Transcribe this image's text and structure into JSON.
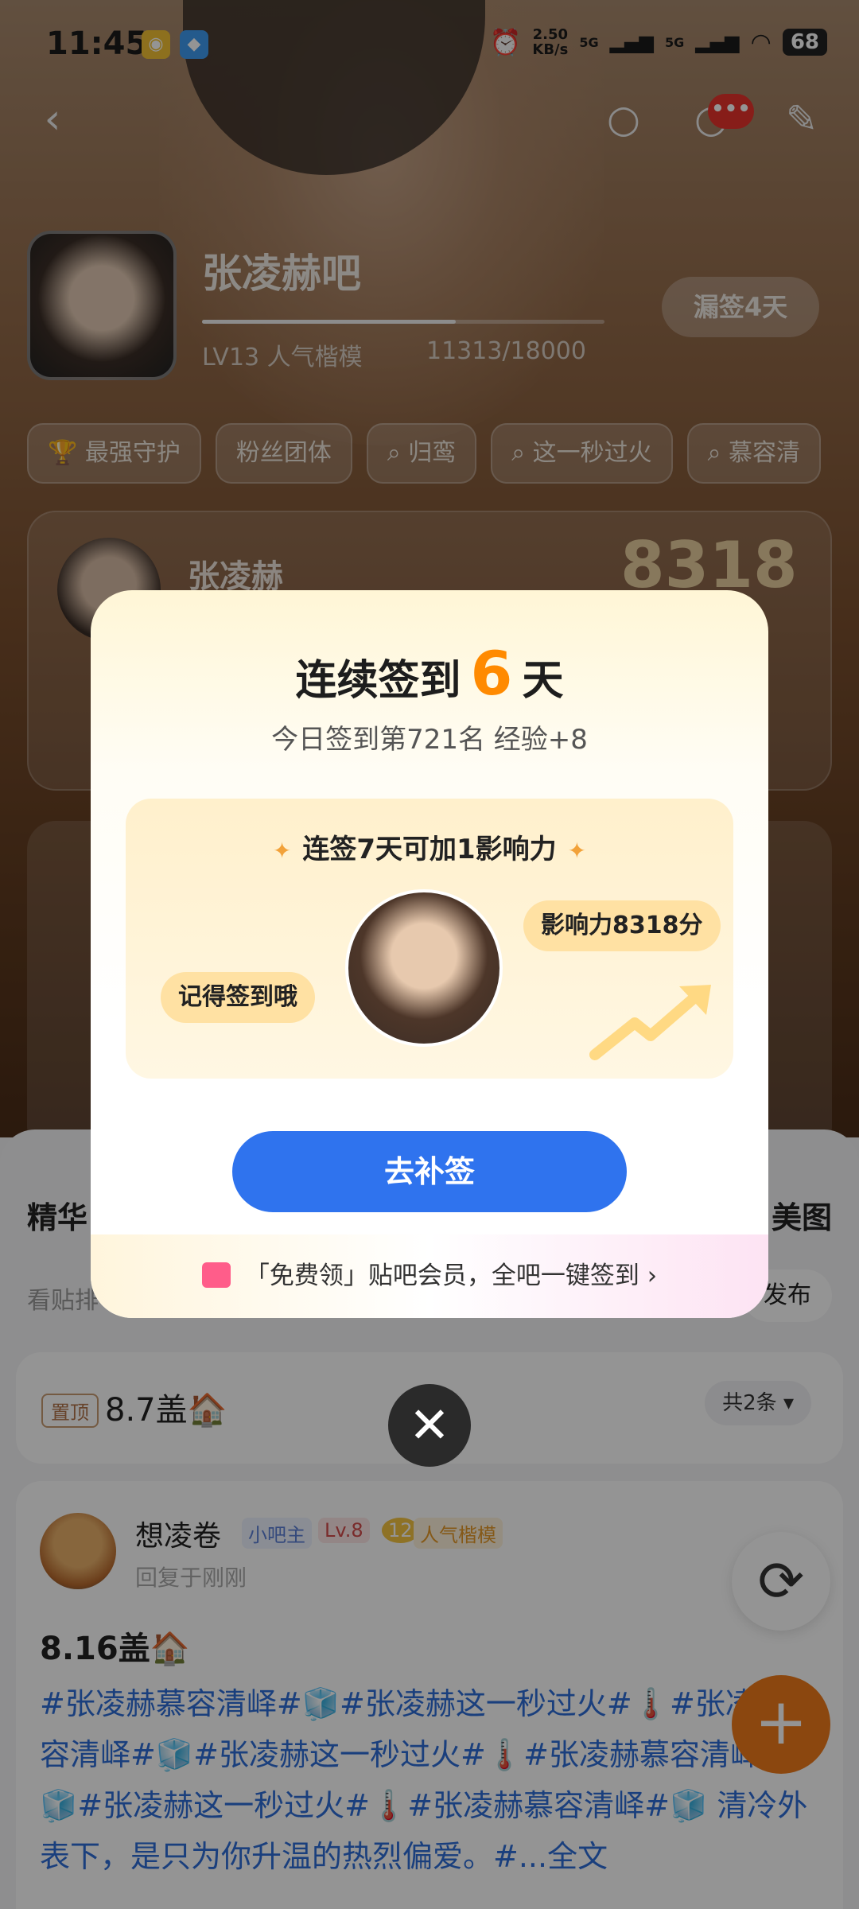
{
  "status": {
    "time": "11:45",
    "net_speed_value": "2.50",
    "net_speed_unit": "KB/s",
    "signal_1": "5G",
    "signal_2": "5G",
    "battery": "68"
  },
  "forum": {
    "name": "张凌赫吧",
    "level": "LV13 人气楷模",
    "exp": "11313/18000",
    "exp_progress": 0.63,
    "miss_button": "漏签4天"
  },
  "tags": [
    "最强守护",
    "粉丝团体",
    "归鸾",
    "这一秒过火",
    "慕容清"
  ],
  "rank": {
    "name": "张凌赫",
    "score": "8318"
  },
  "feed": {
    "title": "精华",
    "right": "美图",
    "sub": "看贴排",
    "publish": "发布",
    "pinned": {
      "tag": "置顶",
      "title": "8.7盖🏠",
      "count": "共2条"
    },
    "post": {
      "author": "想凌卷",
      "badge_owner": "小吧主",
      "badge_level": "Lv.8",
      "badge_rank": "12",
      "badge_title": "人气楷模",
      "meta": "回复于刚刚",
      "title": "8.16盖🏠",
      "body": "#张凌赫慕容清峄#🧊#张凌赫这一秒过火#🌡️#张凌赫慕容清峄#🧊#张凌赫这一秒过火#🌡️#张凌赫慕容清峄#🧊#张凌赫这一秒过火#🌡️#张凌赫慕容清峄#🧊 清冷外表下，是只为你升温的热烈偏爱。#...全文"
    }
  },
  "modal": {
    "title_before": "连续签到",
    "days": "6",
    "title_after": "天",
    "subtitle": "今日签到第721名 经验+8",
    "reward_title": "连签7天可加1影响力",
    "bubble_right": "影响力8318分",
    "bubble_left": "记得签到哦",
    "button": "去补签",
    "promo": "「免费领」贴吧会员，全吧一键签到 ›"
  },
  "colors": {
    "accent_blue": "#2f73ee",
    "accent_orange": "#ff8a00",
    "hashtag_blue": "#2d6dd8"
  },
  "icons": [
    "back-icon",
    "search-icon",
    "message-icon",
    "edit-icon",
    "trophy-icon",
    "close-icon",
    "refresh-icon",
    "plus-icon",
    "gift-icon",
    "weibo-icon"
  ]
}
